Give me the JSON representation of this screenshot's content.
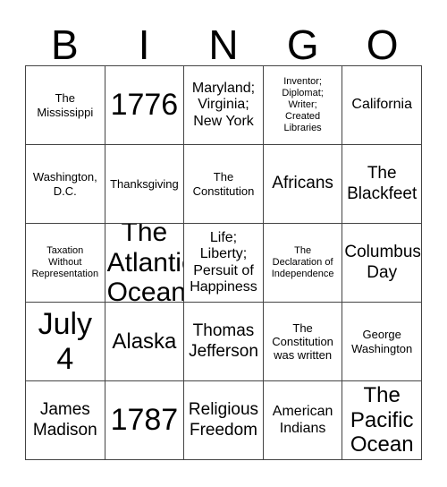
{
  "card": {
    "title_letters": [
      "B",
      "I",
      "N",
      "G",
      "O"
    ],
    "columns": 5,
    "rows": 5,
    "border_color": "#444444",
    "text_color": "#000000",
    "background_color": "#ffffff",
    "cells": [
      [
        {
          "text": "The\nMississippi",
          "size": "s"
        },
        {
          "text": "1776",
          "size": "huge"
        },
        {
          "text": "Maryland;\nVirginia;\nNew York",
          "size": "m"
        },
        {
          "text": "Inventor;\nDiplomat;\nWriter;\nCreated\nLibraries",
          "size": "xs"
        },
        {
          "text": "California",
          "size": "m"
        }
      ],
      [
        {
          "text": "Washington,\nD.C.",
          "size": "s"
        },
        {
          "text": "Thanksgiving",
          "size": "s"
        },
        {
          "text": "The\nConstitution",
          "size": "s"
        },
        {
          "text": "Africans",
          "size": "l"
        },
        {
          "text": "The\nBlackfeet",
          "size": "l"
        }
      ],
      [
        {
          "text": "Taxation\nWithout\nRepresentation",
          "size": "xs"
        },
        {
          "text": "The\nAtlantic\nOcean",
          "size": "xxl"
        },
        {
          "text": "Life;\nLiberty;\nPersuit of\nHappiness",
          "size": "m"
        },
        {
          "text": "The\nDeclaration of\nIndependence",
          "size": "xs"
        },
        {
          "text": "Columbus\nDay",
          "size": "l"
        }
      ],
      [
        {
          "text": "July\n4",
          "size": "huge"
        },
        {
          "text": "Alaska",
          "size": "xl"
        },
        {
          "text": "Thomas\nJefferson",
          "size": "l"
        },
        {
          "text": "The\nConstitution\nwas written",
          "size": "s"
        },
        {
          "text": "George\nWashington",
          "size": "s"
        }
      ],
      [
        {
          "text": "James\nMadison",
          "size": "l"
        },
        {
          "text": "1787",
          "size": "huge"
        },
        {
          "text": "Religious\nFreedom",
          "size": "l"
        },
        {
          "text": "American\nIndians",
          "size": "m"
        },
        {
          "text": "The\nPacific\nOcean",
          "size": "xl"
        }
      ]
    ]
  }
}
